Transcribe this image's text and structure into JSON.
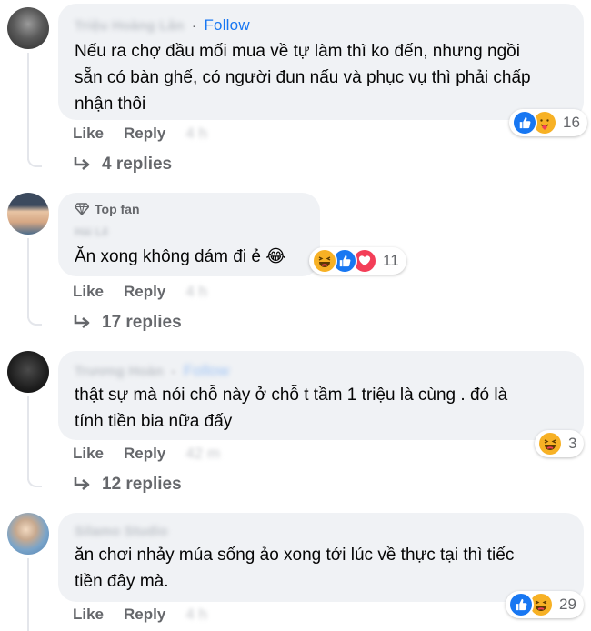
{
  "comments": [
    {
      "author": "Triệu Hoàng Lân",
      "follow": "Follow",
      "text_lines": [
        "Nếu ra chợ đầu mối mua về tự làm thì ko đến, nhưng ngồi",
        "sẵn có bàn ghế, có người đun nấu và phục vụ thì phải chấp",
        "nhận thôi"
      ],
      "reaction_count": "16",
      "reactions": [
        "like",
        "care"
      ],
      "like_label": "Like",
      "reply_label": "Reply",
      "time": "4 h",
      "replies_label": "4 replies"
    },
    {
      "badge": "Top fan",
      "author": "Hải Lê",
      "text_lines": [
        "Ăn xong không dám đi ẻ 😂"
      ],
      "reaction_count": "11",
      "reactions": [
        "haha",
        "like",
        "love"
      ],
      "like_label": "Like",
      "reply_label": "Reply",
      "time": "4 h",
      "replies_label": "17 replies"
    },
    {
      "author": "Trương Hoàn",
      "follow": "Follow",
      "text_lines": [
        "thật sự mà nói chỗ này ở chỗ t tầm 1 triệu là cùng . đó là",
        "tính tiền bia nữa đấy"
      ],
      "reaction_count": "3",
      "reactions": [
        "haha"
      ],
      "like_label": "Like",
      "reply_label": "Reply",
      "time": "42 m",
      "replies_label": "12 replies"
    },
    {
      "author": "Silamo Studio",
      "text_lines": [
        "ăn chơi nhảy múa sống ảo xong tới lúc về thực tại thì tiếc",
        "tiền đây mà."
      ],
      "reaction_count": "29",
      "reactions": [
        "like",
        "haha"
      ],
      "like_label": "Like",
      "reply_label": "Reply",
      "time": "4 h"
    }
  ],
  "colors": {
    "bubble": "#f0f2f5",
    "like": "#1877f2",
    "love": "#f33e58",
    "haha": "#f7b125",
    "meta": "#65676b"
  }
}
